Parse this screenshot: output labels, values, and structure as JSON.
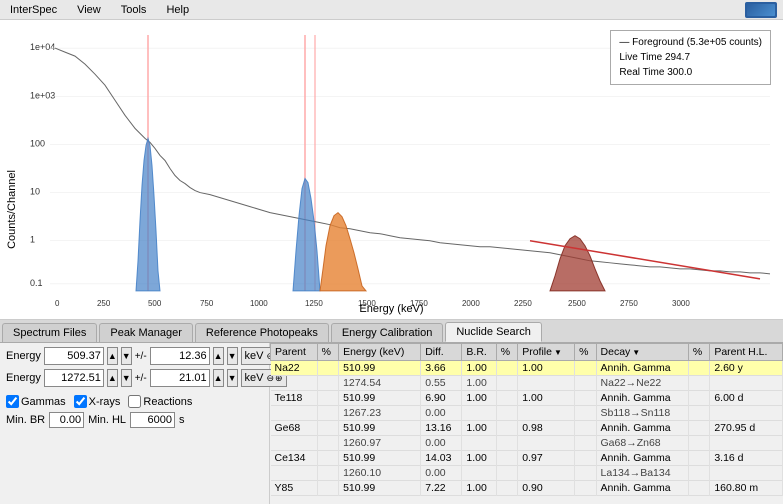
{
  "menubar": {
    "items": [
      "InterSpec",
      "View",
      "Tools",
      "Help"
    ]
  },
  "chart": {
    "yAxisLabel": "Counts/Channel",
    "xAxisLabel": "Energy (keV)",
    "legend": {
      "line1": "— Foreground (5.3e+05 counts)",
      "line2": "Live Time 294.7",
      "line3": "Real Time 300.0"
    }
  },
  "tabs": [
    {
      "label": "Spectrum Files",
      "active": false
    },
    {
      "label": "Peak Manager",
      "active": false
    },
    {
      "label": "Reference Photopeaks",
      "active": false
    },
    {
      "label": "Energy Calibration",
      "active": false
    },
    {
      "label": "Nuclide Search",
      "active": true
    }
  ],
  "controls": {
    "energy1": {
      "label": "Energy",
      "value": "509.37",
      "pm": "+/-",
      "pmval": "12.36",
      "unit": "keV"
    },
    "energy2": {
      "label": "Energy",
      "value": "1272.51",
      "pm": "+/-",
      "pmval": "21.01",
      "unit": "keV"
    },
    "checkboxes": [
      {
        "label": "Gammas",
        "checked": true
      },
      {
        "label": "X-rays",
        "checked": true
      },
      {
        "label": "Reactions",
        "checked": false
      }
    ],
    "minBR": {
      "label": "Min. BR",
      "value": "0.00"
    },
    "minHL": {
      "label": "Min. HL",
      "value": "6000",
      "unit": "s"
    }
  },
  "table": {
    "headers": [
      {
        "label": "Parent",
        "sort": false
      },
      {
        "label": "%",
        "sort": false
      },
      {
        "label": "Energy (keV)",
        "sort": false
      },
      {
        "label": "Diff.",
        "sort": false
      },
      {
        "label": "B.R.",
        "sort": false
      },
      {
        "label": "%",
        "sort": false
      },
      {
        "label": "Profile",
        "sort": true
      },
      {
        "label": "%",
        "sort": false
      },
      {
        "label": "Decay",
        "sort": true
      },
      {
        "label": "%",
        "sort": false
      },
      {
        "label": "Parent H.L.",
        "sort": false
      }
    ],
    "rows": [
      {
        "parent": "Na22",
        "pct1": "",
        "energy": "510.99",
        "diff": "3.66",
        "br": "1.00",
        "pct2": "",
        "profile": "1.00",
        "pct3": "",
        "decay": "Annih. Gamma",
        "pct4": "",
        "hl": "2.60 y",
        "highlight": true
      },
      {
        "parent": "",
        "pct1": "",
        "energy": "1274.54",
        "diff": "0.55",
        "br": "1.00",
        "pct2": "",
        "profile": "",
        "pct3": "",
        "decay": "Na22→Ne22",
        "pct4": "",
        "hl": "",
        "highlight": false
      },
      {
        "parent": "Te118",
        "pct1": "",
        "energy": "510.99",
        "diff": "6.90",
        "br": "1.00",
        "pct2": "",
        "profile": "1.00",
        "pct3": "",
        "decay": "Annih. Gamma",
        "pct4": "",
        "hl": "6.00 d",
        "highlight": false
      },
      {
        "parent": "",
        "pct1": "",
        "energy": "1267.23",
        "diff": "0.00",
        "br": "",
        "pct2": "",
        "profile": "",
        "pct3": "",
        "decay": "Sb118→Sn118",
        "pct4": "",
        "hl": "",
        "highlight": false
      },
      {
        "parent": "Ge68",
        "pct1": "",
        "energy": "510.99",
        "diff": "13.16",
        "br": "1.00",
        "pct2": "",
        "profile": "0.98",
        "pct3": "",
        "decay": "Annih. Gamma",
        "pct4": "",
        "hl": "270.95 d",
        "highlight": false
      },
      {
        "parent": "",
        "pct1": "",
        "energy": "1260.97",
        "diff": "0.00",
        "br": "",
        "pct2": "",
        "profile": "",
        "pct3": "",
        "decay": "Ga68→Zn68",
        "pct4": "",
        "hl": "",
        "highlight": false
      },
      {
        "parent": "Ce134",
        "pct1": "",
        "energy": "510.99",
        "diff": "14.03",
        "br": "1.00",
        "pct2": "",
        "profile": "0.97",
        "pct3": "",
        "decay": "Annih. Gamma",
        "pct4": "",
        "hl": "3.16 d",
        "highlight": false
      },
      {
        "parent": "",
        "pct1": "",
        "energy": "1260.10",
        "diff": "0.00",
        "br": "",
        "pct2": "",
        "profile": "",
        "pct3": "",
        "decay": "La134→Ba134",
        "pct4": "",
        "hl": "",
        "highlight": false
      },
      {
        "parent": "Y85",
        "pct1": "",
        "energy": "510.99",
        "diff": "7.22",
        "br": "1.00",
        "pct2": "",
        "profile": "0.90",
        "pct3": "",
        "decay": "Annih. Gamma",
        "pct4": "",
        "hl": "160.80 m",
        "highlight": false
      }
    ]
  }
}
